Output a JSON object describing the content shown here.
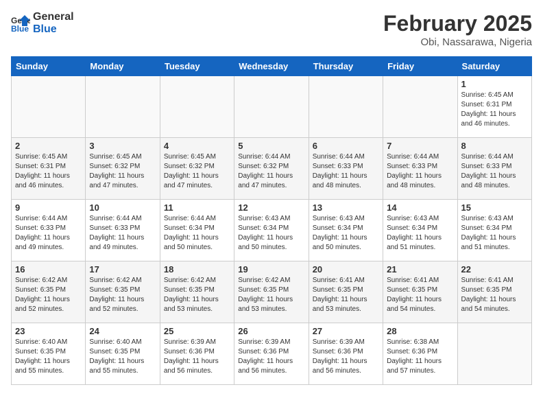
{
  "header": {
    "logo_line1": "General",
    "logo_line2": "Blue",
    "title": "February 2025",
    "subtitle": "Obi, Nassarawa, Nigeria"
  },
  "days_of_week": [
    "Sunday",
    "Monday",
    "Tuesday",
    "Wednesday",
    "Thursday",
    "Friday",
    "Saturday"
  ],
  "weeks": [
    [
      {
        "day": "",
        "info": ""
      },
      {
        "day": "",
        "info": ""
      },
      {
        "day": "",
        "info": ""
      },
      {
        "day": "",
        "info": ""
      },
      {
        "day": "",
        "info": ""
      },
      {
        "day": "",
        "info": ""
      },
      {
        "day": "1",
        "info": "Sunrise: 6:45 AM\nSunset: 6:31 PM\nDaylight: 11 hours\nand 46 minutes."
      }
    ],
    [
      {
        "day": "2",
        "info": "Sunrise: 6:45 AM\nSunset: 6:31 PM\nDaylight: 11 hours\nand 46 minutes."
      },
      {
        "day": "3",
        "info": "Sunrise: 6:45 AM\nSunset: 6:32 PM\nDaylight: 11 hours\nand 47 minutes."
      },
      {
        "day": "4",
        "info": "Sunrise: 6:45 AM\nSunset: 6:32 PM\nDaylight: 11 hours\nand 47 minutes."
      },
      {
        "day": "5",
        "info": "Sunrise: 6:44 AM\nSunset: 6:32 PM\nDaylight: 11 hours\nand 47 minutes."
      },
      {
        "day": "6",
        "info": "Sunrise: 6:44 AM\nSunset: 6:33 PM\nDaylight: 11 hours\nand 48 minutes."
      },
      {
        "day": "7",
        "info": "Sunrise: 6:44 AM\nSunset: 6:33 PM\nDaylight: 11 hours\nand 48 minutes."
      },
      {
        "day": "8",
        "info": "Sunrise: 6:44 AM\nSunset: 6:33 PM\nDaylight: 11 hours\nand 48 minutes."
      }
    ],
    [
      {
        "day": "9",
        "info": "Sunrise: 6:44 AM\nSunset: 6:33 PM\nDaylight: 11 hours\nand 49 minutes."
      },
      {
        "day": "10",
        "info": "Sunrise: 6:44 AM\nSunset: 6:33 PM\nDaylight: 11 hours\nand 49 minutes."
      },
      {
        "day": "11",
        "info": "Sunrise: 6:44 AM\nSunset: 6:34 PM\nDaylight: 11 hours\nand 50 minutes."
      },
      {
        "day": "12",
        "info": "Sunrise: 6:43 AM\nSunset: 6:34 PM\nDaylight: 11 hours\nand 50 minutes."
      },
      {
        "day": "13",
        "info": "Sunrise: 6:43 AM\nSunset: 6:34 PM\nDaylight: 11 hours\nand 50 minutes."
      },
      {
        "day": "14",
        "info": "Sunrise: 6:43 AM\nSunset: 6:34 PM\nDaylight: 11 hours\nand 51 minutes."
      },
      {
        "day": "15",
        "info": "Sunrise: 6:43 AM\nSunset: 6:34 PM\nDaylight: 11 hours\nand 51 minutes."
      }
    ],
    [
      {
        "day": "16",
        "info": "Sunrise: 6:42 AM\nSunset: 6:35 PM\nDaylight: 11 hours\nand 52 minutes."
      },
      {
        "day": "17",
        "info": "Sunrise: 6:42 AM\nSunset: 6:35 PM\nDaylight: 11 hours\nand 52 minutes."
      },
      {
        "day": "18",
        "info": "Sunrise: 6:42 AM\nSunset: 6:35 PM\nDaylight: 11 hours\nand 53 minutes."
      },
      {
        "day": "19",
        "info": "Sunrise: 6:42 AM\nSunset: 6:35 PM\nDaylight: 11 hours\nand 53 minutes."
      },
      {
        "day": "20",
        "info": "Sunrise: 6:41 AM\nSunset: 6:35 PM\nDaylight: 11 hours\nand 53 minutes."
      },
      {
        "day": "21",
        "info": "Sunrise: 6:41 AM\nSunset: 6:35 PM\nDaylight: 11 hours\nand 54 minutes."
      },
      {
        "day": "22",
        "info": "Sunrise: 6:41 AM\nSunset: 6:35 PM\nDaylight: 11 hours\nand 54 minutes."
      }
    ],
    [
      {
        "day": "23",
        "info": "Sunrise: 6:40 AM\nSunset: 6:35 PM\nDaylight: 11 hours\nand 55 minutes."
      },
      {
        "day": "24",
        "info": "Sunrise: 6:40 AM\nSunset: 6:35 PM\nDaylight: 11 hours\nand 55 minutes."
      },
      {
        "day": "25",
        "info": "Sunrise: 6:39 AM\nSunset: 6:36 PM\nDaylight: 11 hours\nand 56 minutes."
      },
      {
        "day": "26",
        "info": "Sunrise: 6:39 AM\nSunset: 6:36 PM\nDaylight: 11 hours\nand 56 minutes."
      },
      {
        "day": "27",
        "info": "Sunrise: 6:39 AM\nSunset: 6:36 PM\nDaylight: 11 hours\nand 56 minutes."
      },
      {
        "day": "28",
        "info": "Sunrise: 6:38 AM\nSunset: 6:36 PM\nDaylight: 11 hours\nand 57 minutes."
      },
      {
        "day": "",
        "info": ""
      }
    ]
  ]
}
